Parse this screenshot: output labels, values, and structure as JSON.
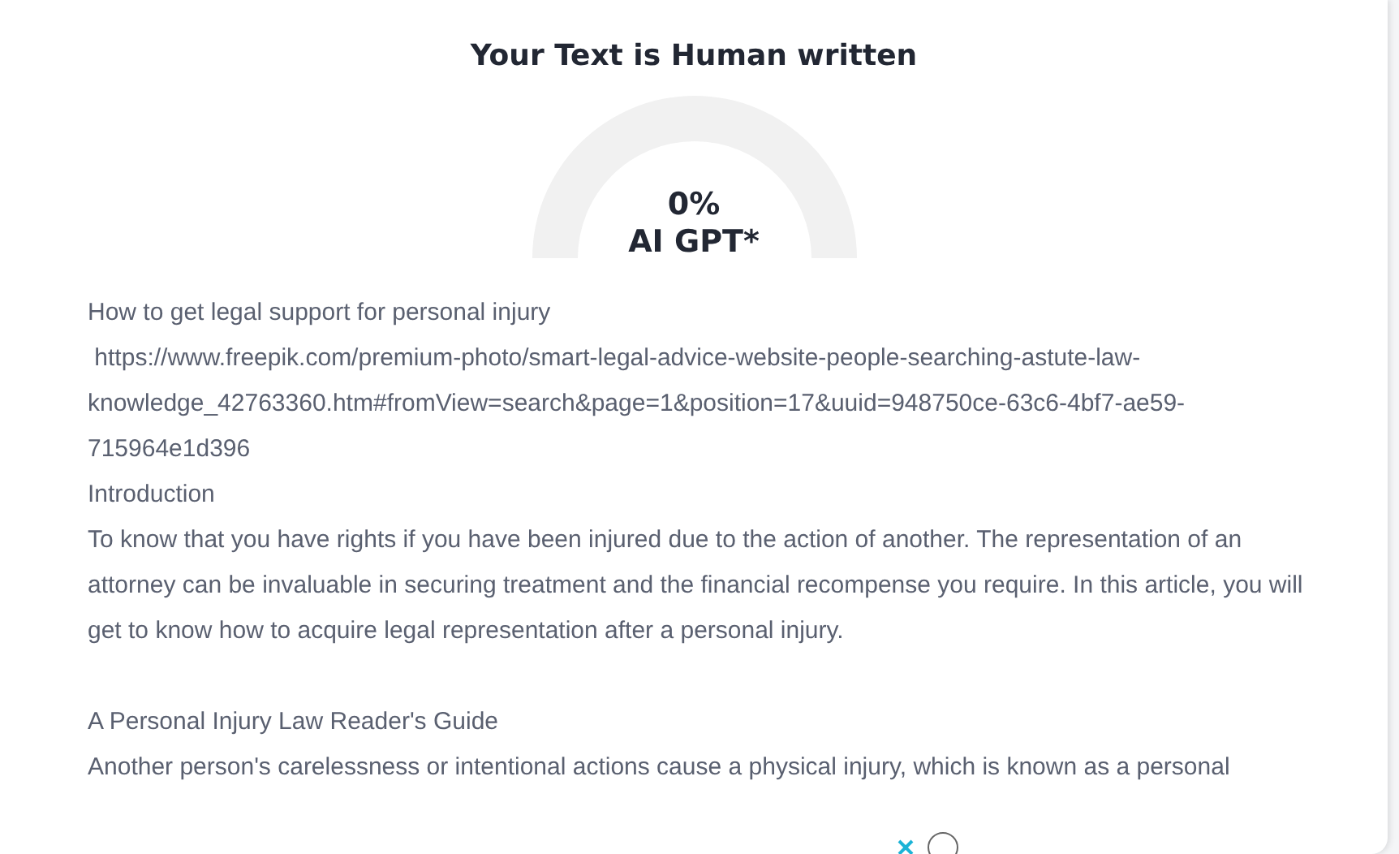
{
  "result": {
    "title": "Your Text is Human written",
    "gauge": {
      "percent": "0%",
      "label": "AI GPT*"
    }
  },
  "sections": [
    {
      "paragraphs": [
        "How to get legal support for personal injury",
        " https://www.freepik.com/premium-photo/smart-legal-advice-website-people-searching-astute-law-knowledge_42763360.htm#fromView=search&page=1&position=17&uuid=948750ce-63c6-4bf7-ae59-715964e1d396",
        "Introduction",
        "To know that you have rights if you have been injured due to the action of another. The representation of an attorney can be invaluable in securing treatment and the financial recompense you require. In this article, you will get to know how to acquire legal representation after a personal injury."
      ]
    },
    {
      "paragraphs": [
        "A Personal Injury Law Reader's Guide",
        "Another person's carelessness or intentional actions cause a physical injury, which is known as a personal"
      ]
    }
  ]
}
